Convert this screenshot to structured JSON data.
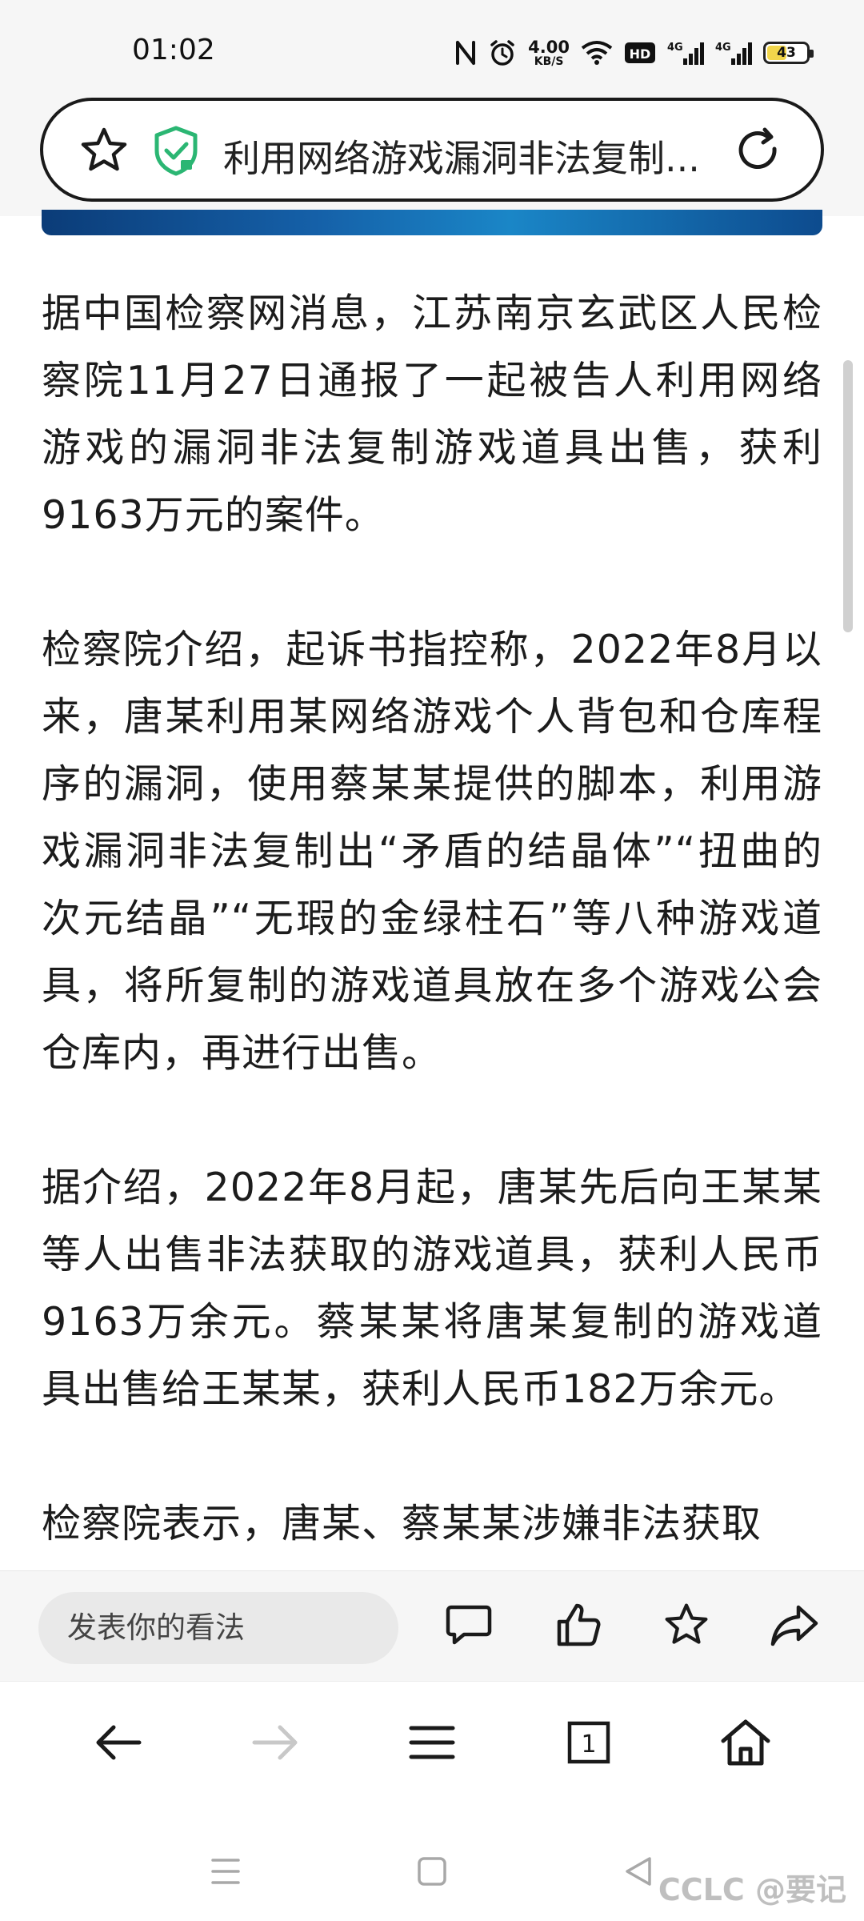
{
  "status_bar": {
    "time": "01:02",
    "net_speed_value": "4.00",
    "net_speed_unit": "KB/S",
    "hd_label": "HD",
    "signal1_label": "4G",
    "signal2_label": "4G",
    "battery_level": "43",
    "battery_color": "#f2d64b"
  },
  "address_bar": {
    "title": "利用网络游戏漏洞非法复制...",
    "security_color": "#2bb673"
  },
  "article": {
    "paragraphs": [
      "据中国检察网消息，江苏南京玄武区人民检察院11月27日通报了一起被告人利用网络游戏的漏洞非法复制游戏道具出售，获利9163万元的案件。",
      "检察院介绍，起诉书指控称，2022年8月以来，唐某利用某网络游戏个人背包和仓库程序的漏洞，使用蔡某某提供的脚本，利用游戏漏洞非法复制出“矛盾的结晶体”“扭曲的次元结晶”“无瑕的金绿柱石”等八种游戏道具，将所复制的游戏道具放在多个游戏公会仓库内，再进行出售。",
      "据介绍，2022年8月起，唐某先后向王某某等人出售非法获取的游戏道具，获利人民币9163万余元。蔡某某将唐某复制的游戏道具出售给王某某，获利人民币182万余元。",
      "检察院表示，唐某、蔡某某涉嫌非法获取"
    ]
  },
  "comment_bar": {
    "placeholder": "发表你的看法",
    "icons": [
      "comment-icon",
      "thumbs-up-icon",
      "favorite-star-icon",
      "share-icon"
    ]
  },
  "browser_nav": {
    "tab_count": "1",
    "icons": [
      "back-arrow-icon",
      "forward-arrow-icon",
      "menu-icon",
      "tabs-icon",
      "home-icon"
    ]
  },
  "system_nav": {
    "icons": [
      "recents-icon",
      "home-square-icon",
      "back-triangle-icon"
    ],
    "watermark": "CCLC @要记"
  }
}
